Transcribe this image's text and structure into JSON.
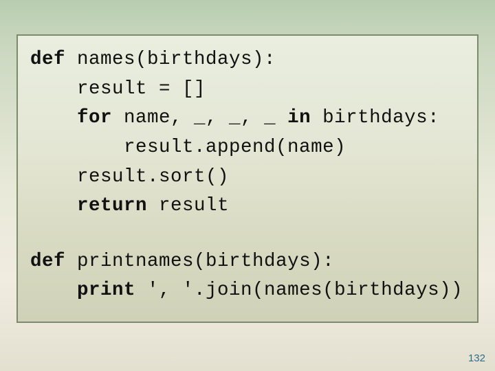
{
  "code": {
    "l1a": "def",
    "l1b": " names(birthdays):",
    "l2": "    result = []",
    "l3a": "    ",
    "l3b": "for",
    "l3c": " name, _, _, _ ",
    "l3d": "in",
    "l3e": " birthdays:",
    "l4": "        result.append(name)",
    "l5": "    result.sort()",
    "l6a": "    ",
    "l6b": "return",
    "l6c": " result",
    "l7a": "def",
    "l7b": " printnames(birthdays):",
    "l8a": "    ",
    "l8b": "print",
    "l8c": " ', '.join(names(birthdays))"
  },
  "page_number": "132"
}
